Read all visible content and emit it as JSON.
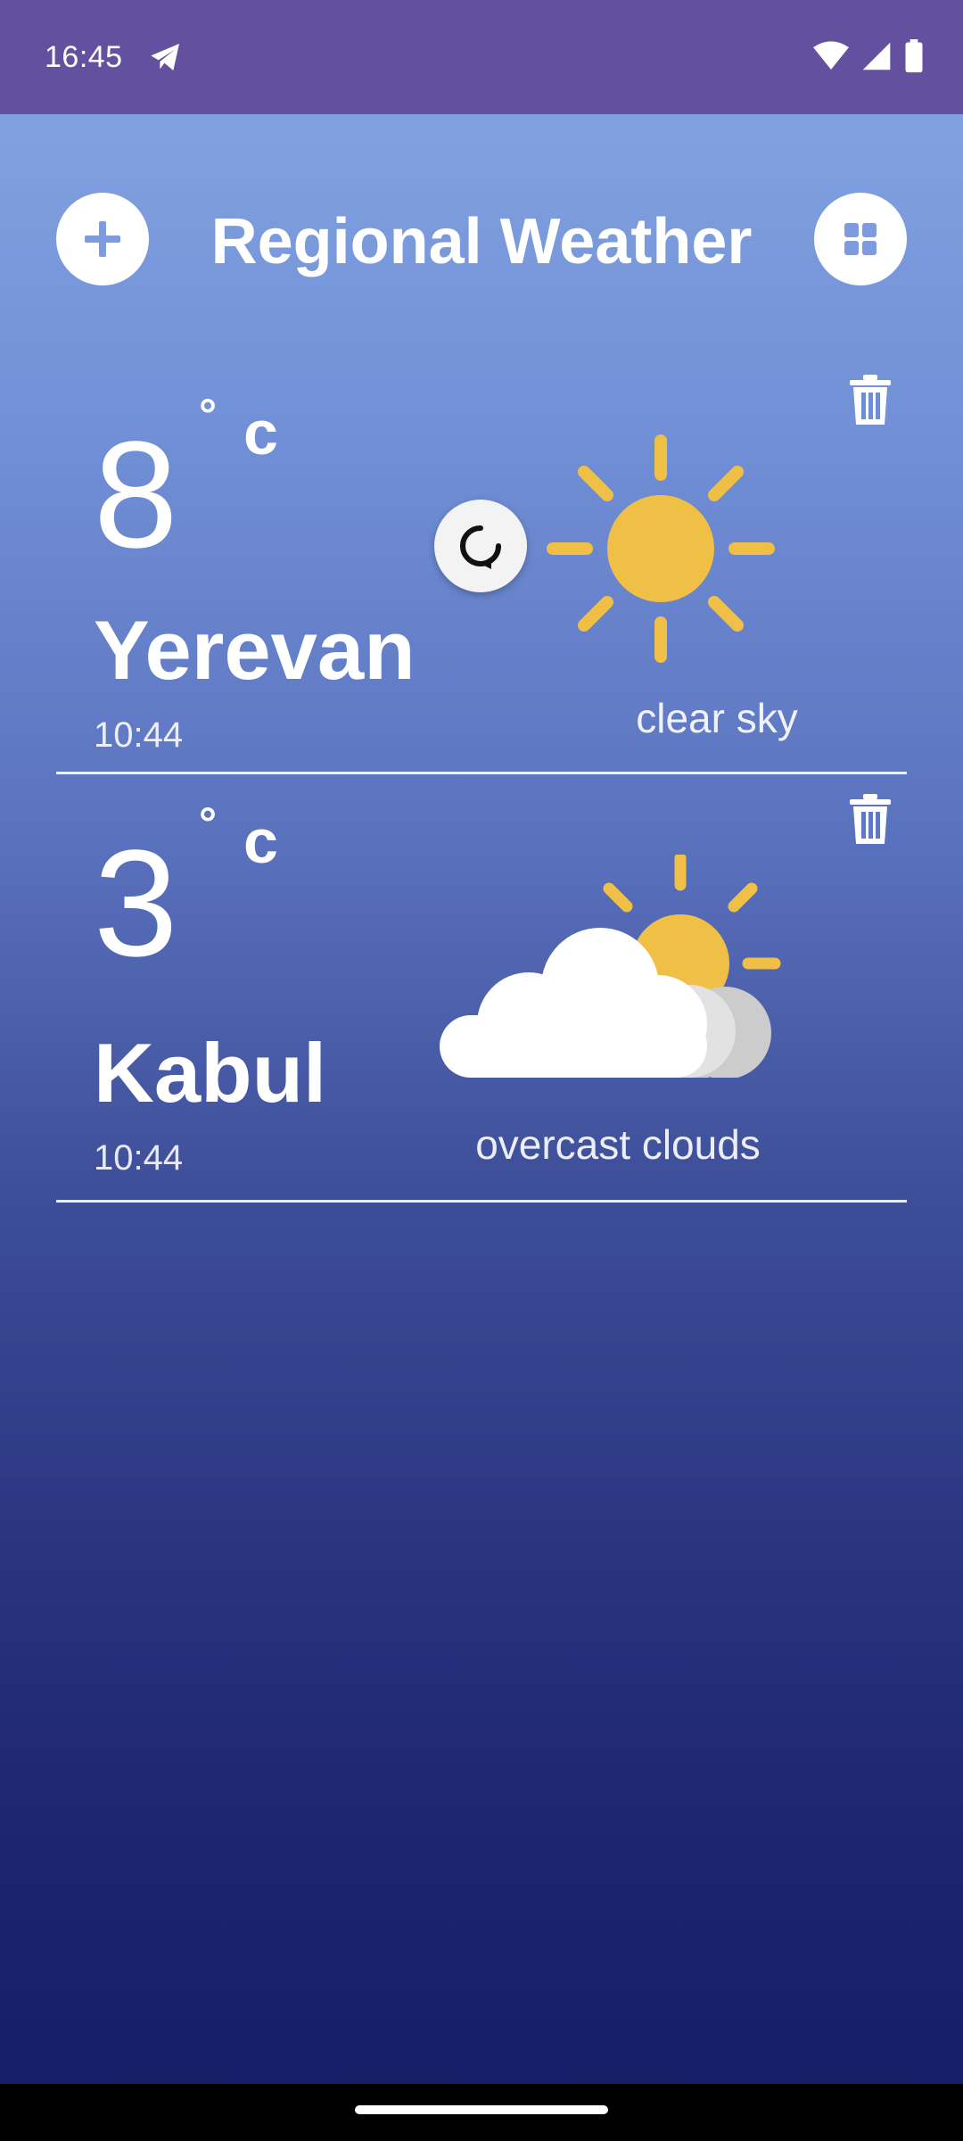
{
  "status_bar": {
    "time": "16:45",
    "background": "#63519f",
    "icons": [
      "telegram-icon",
      "wifi-icon",
      "signal-icon",
      "battery-icon"
    ]
  },
  "header": {
    "title": "Regional Weather",
    "add_icon": "plus-icon",
    "grid_icon": "grid-icon"
  },
  "cards": [
    {
      "temperature": "8",
      "degree_symbol": "°",
      "unit": "c",
      "city": "Yerevan",
      "time": "10:44",
      "condition": "clear sky",
      "icon": "sun-icon"
    },
    {
      "temperature": "3",
      "degree_symbol": "°",
      "unit": "c",
      "city": "Kabul",
      "time": "10:44",
      "condition": "overcast clouds",
      "icon": "cloud-sun-icon"
    }
  ],
  "refresh_icon": "refresh-icon",
  "colors": {
    "sun": "#f0bf45",
    "gradient_top": "#87a7e4",
    "gradient_bottom": "#161b66"
  }
}
